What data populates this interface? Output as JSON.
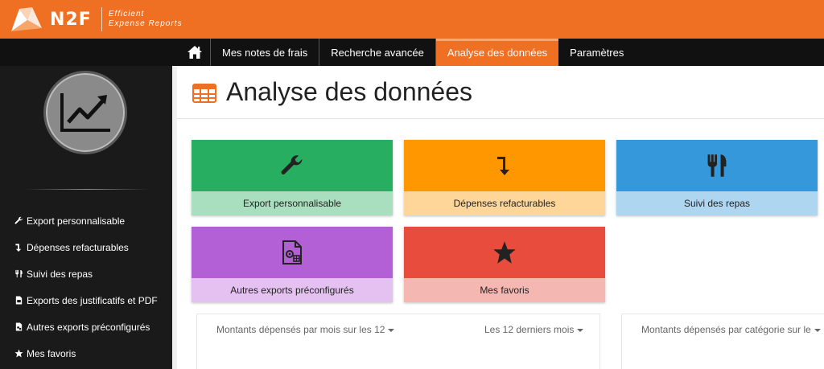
{
  "header": {
    "logo_text": "N2F",
    "tagline_line1": "Efficient",
    "tagline_line2": "Expense Reports"
  },
  "nav": {
    "items": [
      {
        "label": "Mes notes de frais",
        "active": false
      },
      {
        "label": "Recherche avancée",
        "active": false
      },
      {
        "label": "Analyse des données",
        "active": true
      },
      {
        "label": "Paramètres",
        "active": false
      }
    ]
  },
  "sidebar": {
    "items": [
      {
        "label": "Export personnalisable",
        "icon": "wrench-icon"
      },
      {
        "label": "Dépenses refacturables",
        "icon": "arrow-down-turn-icon"
      },
      {
        "label": "Suivi des repas",
        "icon": "utensils-icon"
      },
      {
        "label": "Exports des justificatifs et PDF",
        "icon": "file-pdf-icon"
      },
      {
        "label": "Autres exports préconfigurés",
        "icon": "file-config-icon"
      },
      {
        "label": "Mes favoris",
        "icon": "star-icon"
      }
    ]
  },
  "page": {
    "title": "Analyse des données",
    "title_icon": "table-icon"
  },
  "tiles": [
    {
      "label": "Export personnalisable",
      "icon": "wrench-icon",
      "top_color": "#27ae60",
      "bottom_color": "#a9dfbf"
    },
    {
      "label": "Dépenses refacturables",
      "icon": "arrow-down-turn-icon",
      "top_color": "#ff9800",
      "bottom_color": "#ffd699"
    },
    {
      "label": "Suivi des repas",
      "icon": "utensils-icon",
      "top_color": "#3498db",
      "bottom_color": "#aed6f1"
    },
    {
      "label": "Autres exports préconfigurés",
      "icon": "file-config-icon",
      "top_color": "#b35fd6",
      "bottom_color": "#e4c1f1"
    },
    {
      "label": "Mes favoris",
      "icon": "star-icon",
      "top_color": "#e74c3c",
      "bottom_color": "#f5b7b1"
    }
  ],
  "cards": {
    "monthly": {
      "dropdown_label": "Montants dépensés par mois sur les 12",
      "period_label": "Les 12 derniers mois"
    },
    "category": {
      "dropdown_label": "Montants dépensés par catégorie sur le"
    }
  },
  "colors": {
    "brand_orange": "#ef6f23",
    "nav_bg": "#111111",
    "sidebar_bg": "#1a1a1a"
  }
}
